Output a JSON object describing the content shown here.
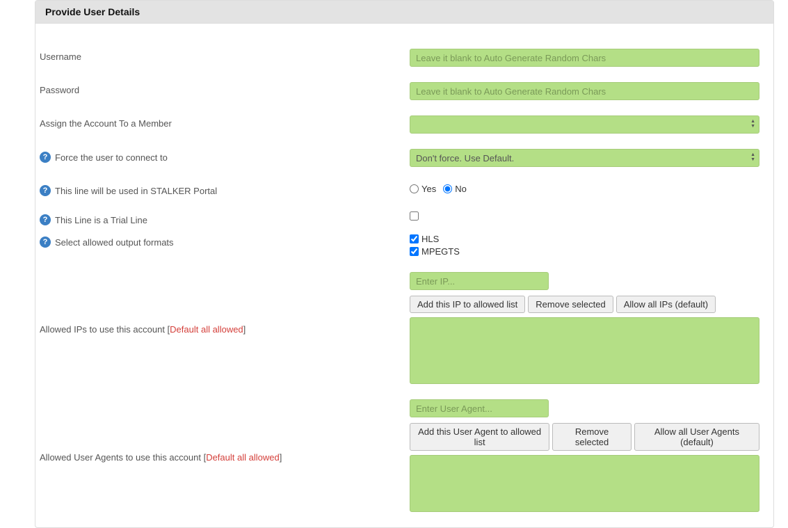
{
  "header": {
    "title": "Provide User Details"
  },
  "fields": {
    "username": {
      "label": "Username",
      "placeholder": "Leave it blank to Auto Generate Random Chars"
    },
    "password": {
      "label": "Password",
      "placeholder": "Leave it blank to Auto Generate Random Chars"
    },
    "assign_member": {
      "label": "Assign the Account To a Member",
      "selected": ""
    },
    "force_connect": {
      "label": "Force the user to connect to",
      "selected": "Don't force. Use Default."
    },
    "stalker": {
      "label": "This line will be used in STALKER Portal",
      "options": {
        "yes": "Yes",
        "no": "No"
      },
      "value": "no"
    },
    "trial": {
      "label": "This Line is a Trial Line",
      "checked": false
    },
    "formats": {
      "label": "Select allowed output formats",
      "hls": {
        "label": "HLS",
        "checked": true
      },
      "mpegts": {
        "label": "MPEGTS",
        "checked": true
      }
    },
    "allowed_ips": {
      "label_prefix": "Allowed IPs to use this account [",
      "label_note": "Default all allowed",
      "label_suffix": "]",
      "input_placeholder": "Enter IP...",
      "buttons": {
        "add": "Add this IP to allowed list",
        "remove": "Remove selected",
        "allow_all": "Allow all IPs (default)"
      }
    },
    "allowed_agents": {
      "label_prefix": "Allowed User Agents to use this account [",
      "label_note": "Default all allowed",
      "label_suffix": "]",
      "input_placeholder": "Enter User Agent...",
      "buttons": {
        "add": "Add this User Agent to allowed list",
        "remove": "Remove selected",
        "allow_all": "Allow all User Agents (default)"
      }
    }
  }
}
